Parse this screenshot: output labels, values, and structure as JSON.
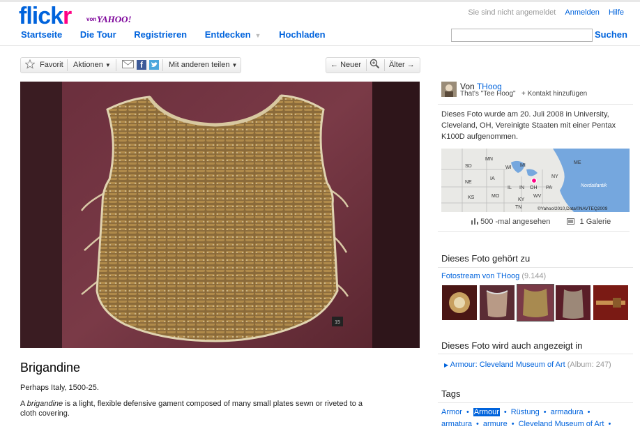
{
  "header": {
    "logo_flickr": "flickr",
    "logo_von": "von",
    "logo_yahoo": "YAHOO!",
    "status": "Sie sind nicht angemeldet",
    "login": "Anmelden",
    "help": "Hilfe",
    "nav": [
      "Startseite",
      "Die Tour",
      "Registrieren",
      "Entdecken",
      "Hochladen"
    ],
    "search_button": "Suchen",
    "search_value": ""
  },
  "toolbar": {
    "favorite": "Favorit",
    "actions": "Aktionen",
    "share": "Mit anderen teilen",
    "newer": "Neuer",
    "older": "Älter"
  },
  "photo": {
    "placard": "15",
    "title": "Brigandine",
    "origin": "Perhaps Italy, 1500-25.",
    "desc_prefix": "A ",
    "desc_em": "brigandine",
    "desc_rest": " is a light, flexible defensive gament composed of many small plates sewn or riveted to a cloth covering."
  },
  "owner": {
    "von": "Von",
    "name": "THoog",
    "nickname": "That's \"Tee Hoog\"",
    "add_contact": "+ Kontakt hinzufügen"
  },
  "taken_info": "Dieses Foto wurde am 20. Juli 2008 in University, Cleveland, OH, Vereinigte Staaten mit einer Pentax K100D aufgenommen.",
  "map": {
    "labels": [
      "SD",
      "MN",
      "WI",
      "MI",
      "NY",
      "ME",
      "NE",
      "IA",
      "IL",
      "IN",
      "OH",
      "PA",
      "KS",
      "MO",
      "KY",
      "WV",
      "TN",
      "Nordatlantik"
    ],
    "credit": "©Yahoo!2010,Data©NAVTEQ2009"
  },
  "stats": {
    "views": "500 -mal angesehen",
    "galleries": "1 Galerie"
  },
  "belongs": {
    "heading": "Dieses Foto gehört zu",
    "stream": "Fotostream von THoog",
    "count": "(9.144)"
  },
  "also": {
    "heading": "Dieses Foto wird auch angezeigt in",
    "album": "Armour: Cleveland Museum of Art",
    "album_count": "(Album: 247)"
  },
  "tags": {
    "heading": "Tags",
    "row1": [
      "Armor",
      "Armour",
      "Rüstung",
      "armadura"
    ],
    "row2": [
      "armatura",
      "armure",
      "Cleveland Museum of Art"
    ]
  }
}
